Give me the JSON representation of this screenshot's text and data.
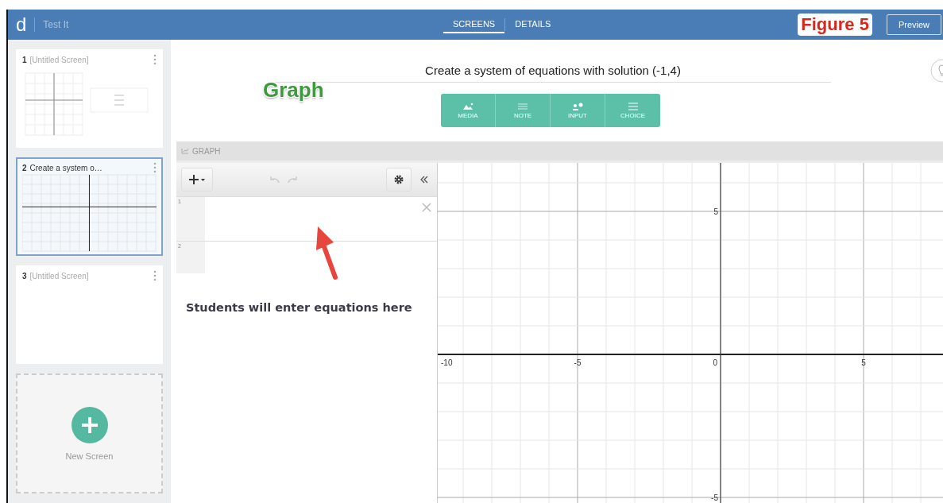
{
  "header": {
    "logo": "d",
    "title": "Test It",
    "tabs": [
      {
        "label": "SCREENS",
        "selected": true
      },
      {
        "label": "DETAILS",
        "selected": false
      }
    ],
    "preview_button": "Preview"
  },
  "annotations": {
    "figure_label": "Figure 5",
    "graph_label": "Graph",
    "callout": "Students will enter equations here"
  },
  "sidebar": {
    "screens": [
      {
        "number": "1",
        "title": "[Untitled Screen]",
        "untitled": true,
        "selected": false,
        "kind": "graph-and-choice"
      },
      {
        "number": "2",
        "title": "Create a system o…",
        "untitled": false,
        "selected": true,
        "kind": "graph"
      },
      {
        "number": "3",
        "title": "[Untitled Screen]",
        "untitled": true,
        "selected": false,
        "kind": "empty"
      }
    ],
    "new_screen": "New Screen"
  },
  "prompt": "Create a system of equations with solution (-1,4)",
  "component_buttons": [
    {
      "label": "MEDIA",
      "kind": "media"
    },
    {
      "label": "NOTE",
      "kind": "note"
    },
    {
      "label": "INPUT",
      "kind": "input"
    },
    {
      "label": "CHOICE",
      "kind": "choice"
    }
  ],
  "graph_component": {
    "header": "GRAPH",
    "expression_numbers": [
      "1",
      "2"
    ],
    "x_tick_labels": [
      "-10",
      "-5",
      "0",
      "5"
    ],
    "y_tick_labels": [
      "5",
      "-5"
    ]
  }
}
